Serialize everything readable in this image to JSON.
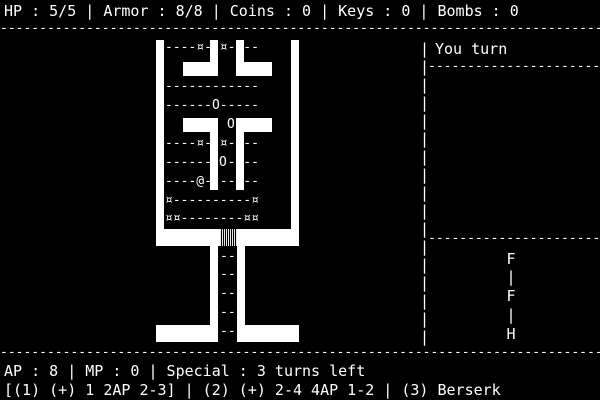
{
  "status": {
    "hp": "HP : 5/5",
    "armor": "Armor : 8/8",
    "coins": "Coins : 0",
    "keys": "Keys : 0",
    "bombs": "Bombs : 0"
  },
  "map": {
    "player": "@",
    "orb": "O",
    "item": "¤",
    "row_a": "----¤--¤----",
    "row_b": "------O-----",
    "row_c": "----¤--¤----",
    "row_d": "----@-------",
    "row_e": "¤----------¤",
    "row_f": "¤¤--------¤¤",
    "corridor": "--"
  },
  "side": {
    "turn_label": "You turn",
    "queue": [
      "F",
      "|",
      "F",
      "|",
      "H"
    ]
  },
  "bottom": {
    "stats": "AP : 8 | MP : 0 | Special : 3 turns left",
    "actions": "[(1) (+) 1 2AP 2-3] | (2) (+) 2-4 4AP 1-2 | (3) Berserk"
  }
}
